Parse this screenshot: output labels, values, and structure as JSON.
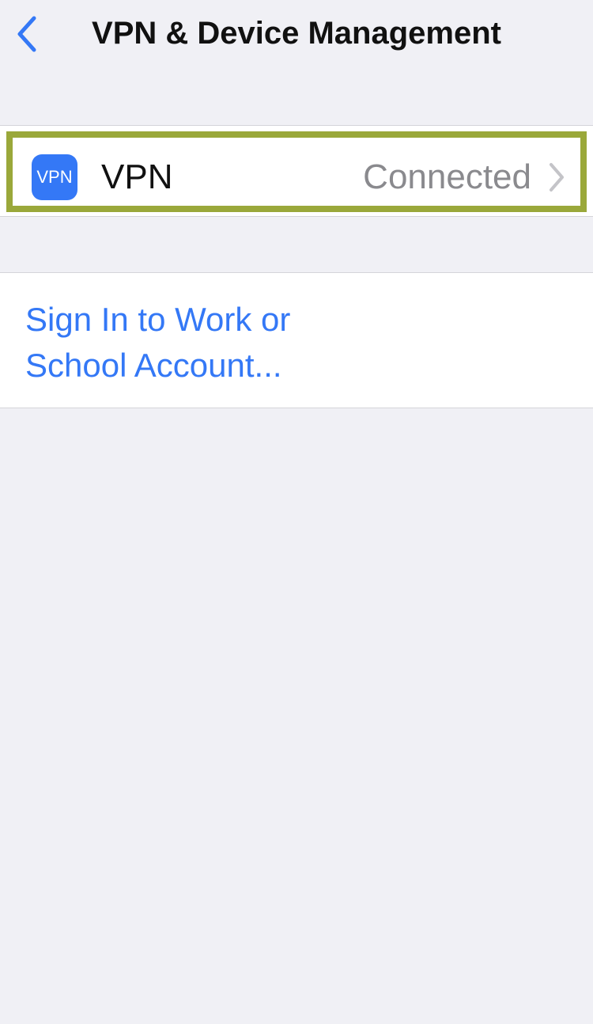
{
  "header": {
    "title": "VPN & Device Management",
    "back_icon": "chevron-left-icon"
  },
  "vpn_row": {
    "icon_text": "VPN",
    "label": "VPN",
    "status": "Connected",
    "chevron_icon": "chevron-right-icon"
  },
  "account": {
    "link_text": "Sign In to Work or School Account..."
  },
  "colors": {
    "accent": "#3478F6",
    "highlight_border": "#9AA83A",
    "background": "#F0F0F5",
    "secondary_text": "#8A8A8E"
  }
}
